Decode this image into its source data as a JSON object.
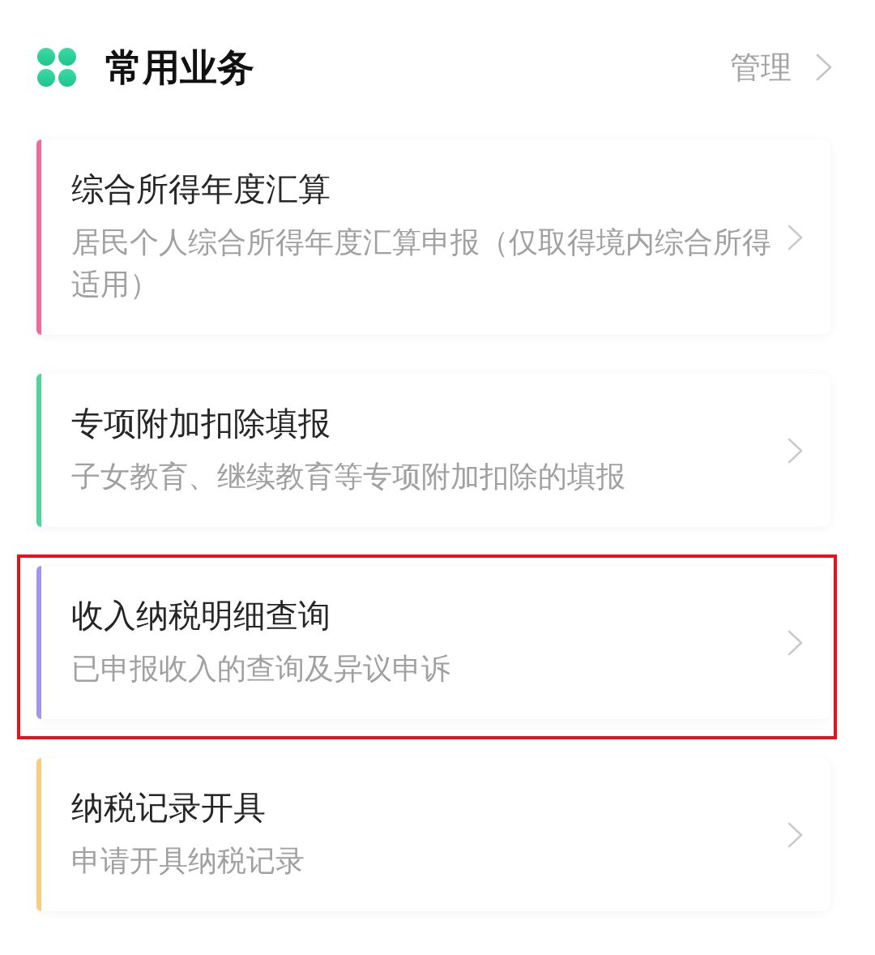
{
  "header": {
    "title": "常用业务",
    "manage_link": "管理"
  },
  "cards": [
    {
      "title": "综合所得年度汇算",
      "subtitle": "居民个人综合所得年度汇算申报（仅取得境内综合所得适用）",
      "color": "#f06b9a",
      "highlighted": false
    },
    {
      "title": "专项附加扣除填报",
      "subtitle": "子女教育、继续教育等专项附加扣除的填报",
      "color": "#4dd69c",
      "highlighted": false
    },
    {
      "title": "收入纳税明细查询",
      "subtitle": "已申报收入的查询及异议申诉",
      "color": "#9d96f2",
      "highlighted": true
    },
    {
      "title": "纳税记录开具",
      "subtitle": "申请开具纳税记录",
      "color": "#f8cd7c",
      "highlighted": false
    }
  ]
}
